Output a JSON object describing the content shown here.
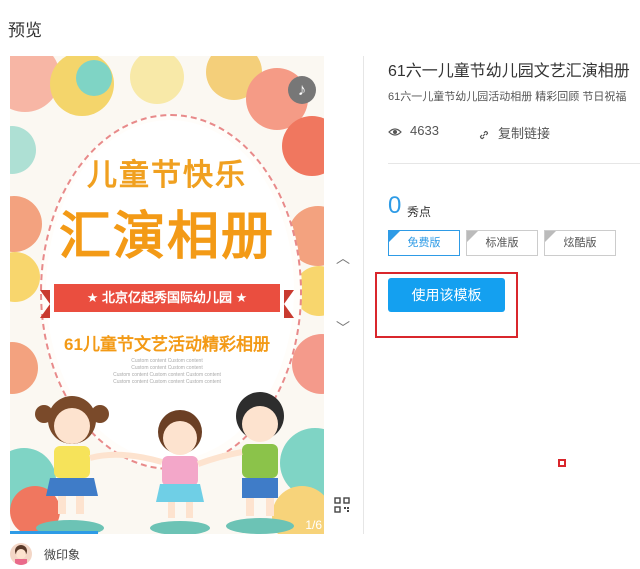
{
  "header": {
    "title": "预览"
  },
  "poster": {
    "heading": "儿童节快乐",
    "title": "汇演相册",
    "ribbon": "★ 北京亿起秀国际幼儿园 ★",
    "subtitle": "61儿童节文艺活动精彩相册",
    "placeholder_lines": [
      "Custom content  Custom content",
      "Custom content  Custom content",
      "Custom content  Custom content  Custom content",
      "Custom content  Custom content  Custom content"
    ],
    "page_indicator": "1/6",
    "music_icon": "music-note-icon"
  },
  "info": {
    "title": "61六一儿童节幼儿园文艺汇演相册",
    "description": "61六一儿童节幼儿园活动相册 精彩回顾 节日祝福",
    "views": "4633",
    "copy_link": "复制链接",
    "price": "0",
    "price_unit": "秀点",
    "versions": [
      {
        "label": "免费版",
        "active": true
      },
      {
        "label": "标准版",
        "active": false
      },
      {
        "label": "炫酷版",
        "active": false
      }
    ],
    "use_button": "使用该模板"
  },
  "footer": {
    "brand": "微印象"
  },
  "colors": {
    "accent": "#2e9be6",
    "button": "#14a0f0",
    "highlight_box": "#d9262c",
    "poster_orange": "#f39a16",
    "ribbon": "#ea4e3f"
  }
}
